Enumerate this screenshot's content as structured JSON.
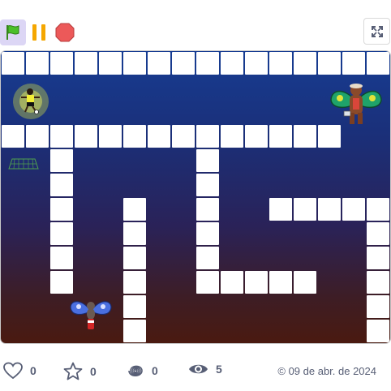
{
  "controls": {
    "green_flag_icon": "green-flag-icon",
    "pause_icon": "pause-icon",
    "stop_icon": "stop-icon",
    "fullscreen_icon": "fullscreen-icon"
  },
  "stage": {
    "colors": {
      "top": "#163c92",
      "bottom": "#4a1a10",
      "wall": "#ffffff"
    },
    "sprites": [
      "soccer-player",
      "brown-bear-with-green-butterfly-wings",
      "goal-net",
      "blue-butterfly-with-soda-can"
    ]
  },
  "stats": {
    "likes": "0",
    "favorites": "0",
    "remixes": "0",
    "views": "5"
  },
  "date": "© 09 de abr. de 2024"
}
